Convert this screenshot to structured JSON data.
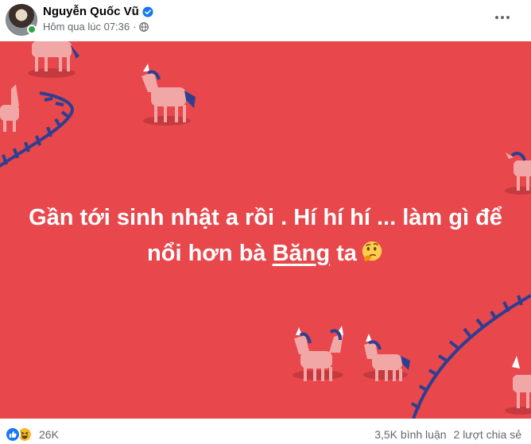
{
  "post": {
    "author": "Nguyễn Quốc Vũ",
    "time": "Hôm qua lúc 07:36",
    "separator": "·",
    "privacy_icon": "globe-icon",
    "line1": "Gần tới sinh nhật a rồi . Hí hí hí ... làm gì để",
    "line2_before": "nổi hơn bà ",
    "mention": "Băng",
    "line2_after": " ta",
    "emoji": "thinking-face",
    "background_color": "#e8474c"
  },
  "footer": {
    "reaction_count": "26K",
    "comments": "3,5K bình luận",
    "shares": "2 lượt chia sẻ"
  },
  "colors": {
    "verified": "#1877f2",
    "online": "#31a24c",
    "unicorn": "#f2a7a7",
    "fence": "#2f3f8f"
  }
}
